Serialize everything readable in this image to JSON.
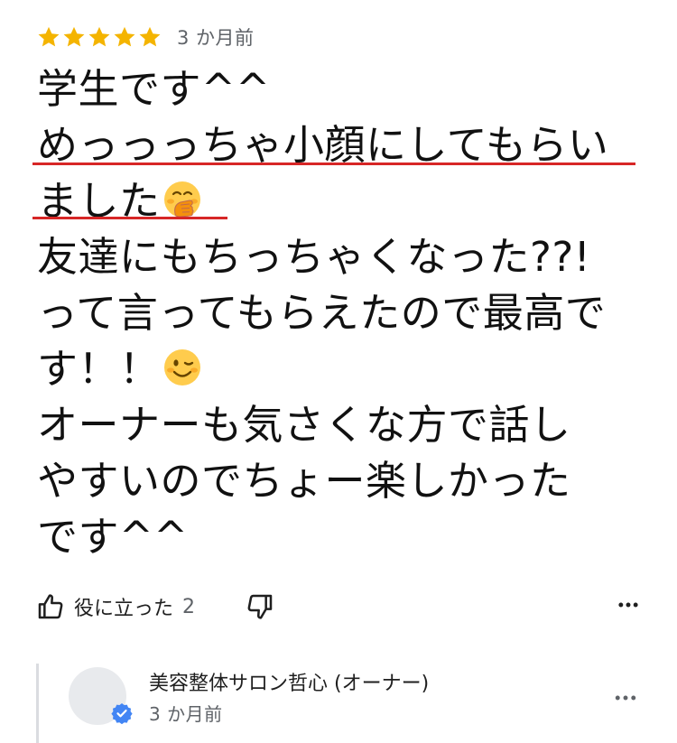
{
  "review": {
    "rating_stars": 5,
    "rating_max": 5,
    "star_color": "#f4b400",
    "time": "3 か月前",
    "lines": [
      "学生です^^",
      "めっっっちゃ小顔にしてもらい",
      "ました",
      "友達にもちっちゃくなった??!",
      "って言ってもらえたので最高で",
      "す！！",
      "オーナーも気さくな方で話し",
      "やすいのでちょー楽しかった",
      "です^^"
    ],
    "emoji": {
      "line_3": "hand-over-mouth-emoji",
      "line_6": "winking-face-emoji"
    },
    "underline_color": "#d72626"
  },
  "actions": {
    "helpful_label": "役に立った",
    "helpful_count": "2",
    "like_icon": "thumbs-up-icon",
    "dislike_icon": "thumbs-down-icon",
    "more_icon": "more-horizontal-icon"
  },
  "owner_reply": {
    "name": "美容整体サロン哲心 (オーナー)",
    "time": "3 か月前",
    "verified_icon": "verified-check-icon",
    "verified_color": "#4285f4",
    "more_icon": "more-horizontal-icon"
  }
}
